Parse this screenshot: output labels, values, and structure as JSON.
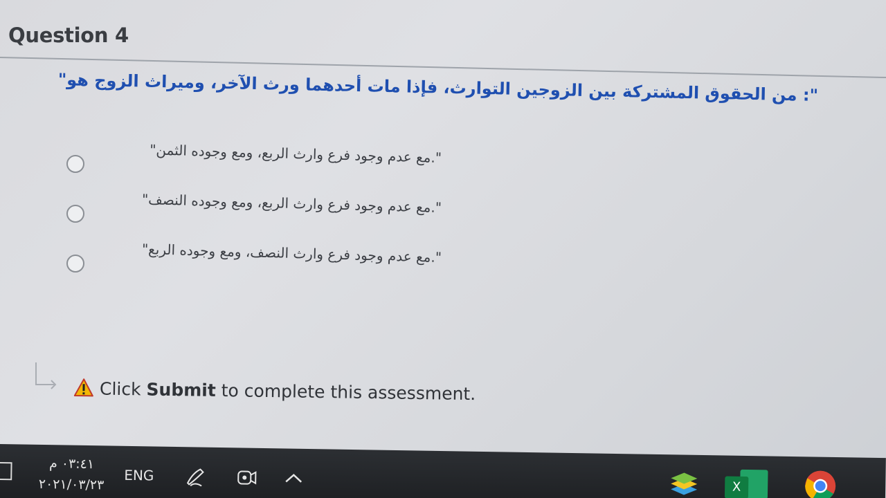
{
  "question": {
    "title": "Question 4",
    "text": "\": من الحقوق المشتركة بين الزوجين التوارث، فإذا مات أحدهما ورث الآخر، وميراث الزوج هو\""
  },
  "options": [
    {
      "label": "\".مع عدم وجود فرع وارث الربع، ومع وجوده الثمن\""
    },
    {
      "label": "\".مع عدم وجود فرع وارث الربع، ومع وجوده النصف\""
    },
    {
      "label": "\".مع عدم وجود فرع وارث النصف، ومع وجوده الربع\""
    }
  ],
  "notice": {
    "prefix": "Click ",
    "bold": "Submit",
    "suffix": " to complete this assessment."
  },
  "taskbar": {
    "time": "٠٣:٤١ م",
    "date": "٢٠٢١/٠٣/٢٣",
    "language": "ENG",
    "excel_letter": "X"
  },
  "colors": {
    "question_text": "#1f4fb0",
    "warning": "#f2b705",
    "taskbar": "#1d1f22"
  },
  "icons": [
    "square-icon",
    "pen-icon",
    "meet-now-icon",
    "chevron-up-icon",
    "bluestacks-icon",
    "excel-icon",
    "chrome-icon",
    "warning-icon",
    "hint-arrow-icon"
  ]
}
